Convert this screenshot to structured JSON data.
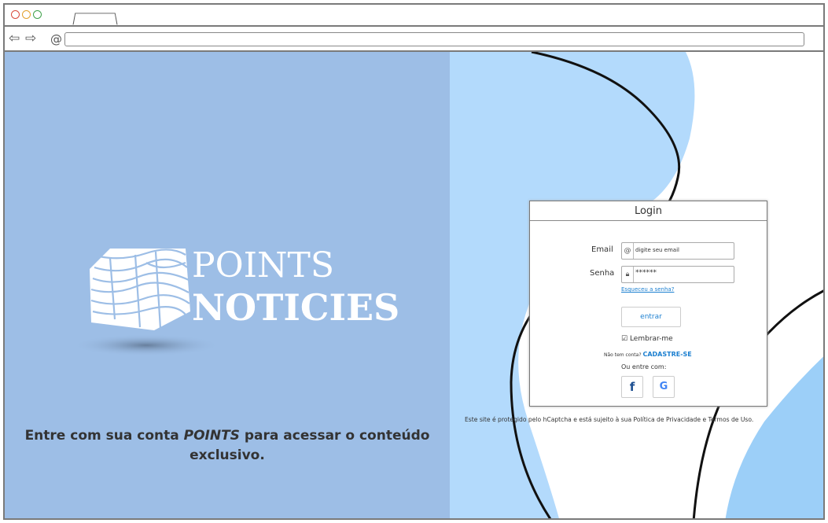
{
  "browser": {
    "back_icon": "⇦",
    "forward_icon": "⇨",
    "site_icon": "@",
    "url_value": ""
  },
  "logo": {
    "line1": "POINTS",
    "line2": "NOTICIES"
  },
  "tagline": {
    "part1": "Entre com sua conta ",
    "brand": "POINTS",
    "part2": " para acessar o conteúdo exclusivo."
  },
  "login": {
    "title": "Login",
    "email_label": "Email",
    "email_placeholder": "digite seu email",
    "password_label": "Senha",
    "password_value": "******",
    "forgot_link": "Esqueceu a senha?",
    "enter_button": "entrar",
    "remember_label": "Lembrar-me",
    "no_account_text": "Não tem conta?",
    "signup_link": "CADASTRE-SE",
    "or_text": "Ou entre com:",
    "facebook_label": "f",
    "google_label": "G"
  },
  "captcha_notice": "Este site é protegido pelo hCaptcha e está sujeito à sua Política de Privacidade e Termos de Uso.",
  "colors": {
    "left_panel": "#9dbee6",
    "blob_light": "#b3dafc",
    "link": "#1b7fd0"
  }
}
